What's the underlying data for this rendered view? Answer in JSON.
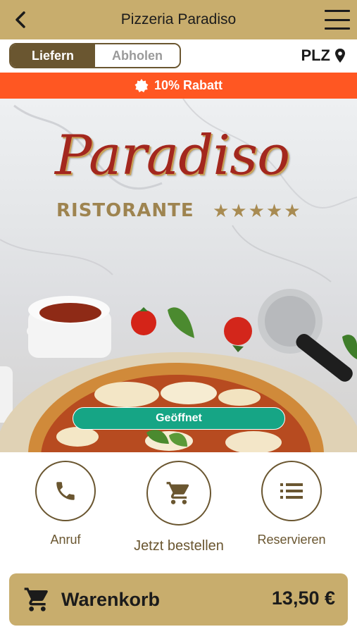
{
  "header": {
    "title": "Pizzeria Paradiso",
    "back_icon": "chevron-left-icon",
    "menu_icon": "hamburger-menu-icon"
  },
  "delivery": {
    "options": [
      "Liefern",
      "Abholen"
    ],
    "selected": "Liefern",
    "plz_label": "PLZ",
    "plz_icon": "location-pin-icon"
  },
  "promo": {
    "text": "10% Rabatt",
    "icon": "badge-icon",
    "color": "#ff5722"
  },
  "hero": {
    "logo_title": "Paradiso",
    "logo_subtitle": "RISTORANTE",
    "rating_stars": 5,
    "status_badge": "Geöffnet",
    "status_color": "#16a585"
  },
  "actions": [
    {
      "label": "Anruf",
      "icon": "phone-icon"
    },
    {
      "label": "Jetzt bestellen",
      "icon": "cart-icon"
    },
    {
      "label": "Reservieren",
      "icon": "list-icon"
    }
  ],
  "cart": {
    "label": "Warenkorb",
    "total": "13,50 €",
    "icon": "cart-icon"
  },
  "colors": {
    "brand_gold": "#c8ad6d",
    "brand_brown": "#6a5630"
  }
}
